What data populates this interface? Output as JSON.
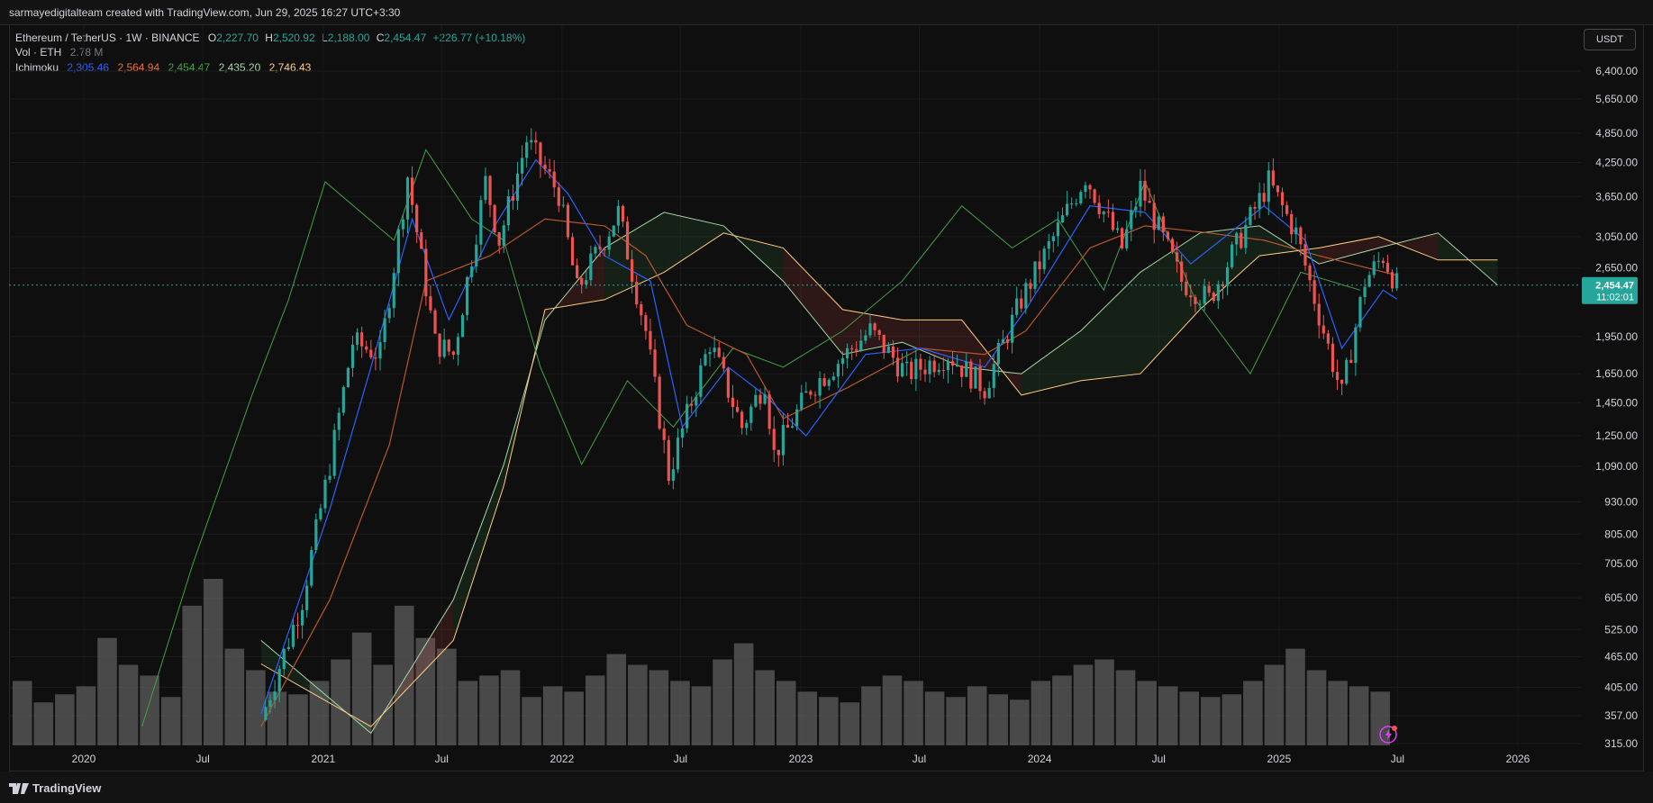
{
  "header": {
    "attribution": "sarmayedigitalteam created with TradingView.com, Jun 29, 2025 16:27 UTC+3:30"
  },
  "legend": {
    "symbol": "Ethereum / TetherUS · 1W · BINANCE",
    "open_label": "O",
    "open": "2,227.70",
    "high_label": "H",
    "high": "2,520.92",
    "low_label": "L",
    "low": "2,188.00",
    "close_label": "C",
    "close": "2,454.47",
    "change": "+226.77 (+10.18%)",
    "volume_label": "Vol · ETH",
    "volume": "2.78 M",
    "ichimoku_label": "Ichimoku",
    "ichimoku_values": [
      "2,305.46",
      "2,564.94",
      "2,454.47",
      "2,435.20",
      "2,746.43"
    ]
  },
  "currency_button": "USDT",
  "last_price": {
    "value": "2,454.47",
    "countdown": "11:02:01"
  },
  "footer": {
    "logo_text": "TradingView"
  },
  "colors": {
    "up": "#26a69a",
    "down": "#ef5350",
    "conversion": "#2962ff",
    "base": "#b7562a",
    "lagging": "#43a047",
    "spanA": "#a5d6a7",
    "spanB": "#ffcc80",
    "volume": "#5d5d5d",
    "price_line": "#26a69a"
  },
  "chart_data": {
    "type": "candlestick",
    "title": "",
    "scale": "log",
    "y_ticks": [
      6400,
      5650,
      4850,
      4250,
      3650,
      3050,
      2650,
      1950,
      1650,
      1450,
      1250,
      1090,
      930,
      805,
      705,
      605,
      525,
      465,
      405,
      357,
      315
    ],
    "y_tick_labels": [
      "6,400.00",
      "5,650.00",
      "4,850.00",
      "4,250.00",
      "3,650.00",
      "3,050.00",
      "2,650.00",
      "1,950.00",
      "1,650.00",
      "1,450.00",
      "1,250.00",
      "1,090.00",
      "930.00",
      "805.00",
      "705.00",
      "605.00",
      "525.00",
      "465.00",
      "405.00",
      "357.00",
      "315.00"
    ],
    "x_labels": [
      "2020",
      "Jul",
      "2021",
      "Jul",
      "2022",
      "Jul",
      "2023",
      "Jul",
      "2024",
      "Jul",
      "2025",
      "Jul",
      "2026"
    ],
    "x_label_dates": [
      "2020-01-01",
      "2020-07-01",
      "2021-01-01",
      "2021-07-01",
      "2022-01-01",
      "2022-07-01",
      "2023-01-01",
      "2023-07-01",
      "2024-01-01",
      "2024-07-01",
      "2025-01-01",
      "2025-07-01",
      "2026-01-01"
    ],
    "price_points": [
      [
        "2020-09-28",
        350
      ],
      [
        "2020-11-30",
        600
      ],
      [
        "2021-01-11",
        1100
      ],
      [
        "2021-02-15",
        1900
      ],
      [
        "2021-03-29",
        1800
      ],
      [
        "2021-05-10",
        4000
      ],
      [
        "2021-06-21",
        1900
      ],
      [
        "2021-07-19",
        1800
      ],
      [
        "2021-09-06",
        3900
      ],
      [
        "2021-09-27",
        3000
      ],
      [
        "2021-11-08",
        4700
      ],
      [
        "2021-12-27",
        3700
      ],
      [
        "2022-01-24",
        2400
      ],
      [
        "2022-03-28",
        3400
      ],
      [
        "2022-05-09",
        2000
      ],
      [
        "2022-06-13",
        1050
      ],
      [
        "2022-08-15",
        1900
      ],
      [
        "2022-10-03",
        1300
      ],
      [
        "2022-11-07",
        1600
      ],
      [
        "2022-11-21",
        1150
      ],
      [
        "2023-01-16",
        1550
      ],
      [
        "2023-04-17",
        2000
      ],
      [
        "2023-06-12",
        1650
      ],
      [
        "2023-08-14",
        1800
      ],
      [
        "2023-10-09",
        1550
      ],
      [
        "2023-12-04",
        2300
      ],
      [
        "2024-03-11",
        4000
      ],
      [
        "2024-05-06",
        2900
      ],
      [
        "2024-06-03",
        3800
      ],
      [
        "2024-08-05",
        2500
      ],
      [
        "2024-09-16",
        2300
      ],
      [
        "2024-12-16",
        3900
      ],
      [
        "2025-01-27",
        3100
      ],
      [
        "2025-03-10",
        2000
      ],
      [
        "2025-04-07",
        1500
      ],
      [
        "2025-05-12",
        2500
      ],
      [
        "2025-06-09",
        2800
      ],
      [
        "2025-06-30",
        2454.47
      ]
    ],
    "conversion_line": [
      [
        "2020-09-28",
        360
      ],
      [
        "2021-01-11",
        900
      ],
      [
        "2021-03-15",
        1700
      ],
      [
        "2021-05-17",
        3300
      ],
      [
        "2021-07-12",
        2100
      ],
      [
        "2021-09-20",
        3200
      ],
      [
        "2021-11-22",
        4300
      ],
      [
        "2022-01-10",
        3700
      ],
      [
        "2022-03-07",
        2800
      ],
      [
        "2022-05-16",
        2500
      ],
      [
        "2022-07-04",
        1300
      ],
      [
        "2022-09-12",
        1700
      ],
      [
        "2022-11-07",
        1500
      ],
      [
        "2023-01-09",
        1250
      ],
      [
        "2023-04-10",
        1800
      ],
      [
        "2023-07-03",
        1850
      ],
      [
        "2023-10-09",
        1700
      ],
      [
        "2023-12-11",
        2200
      ],
      [
        "2024-03-18",
        3500
      ],
      [
        "2024-06-10",
        3400
      ],
      [
        "2024-08-19",
        2700
      ],
      [
        "2024-12-09",
        3500
      ],
      [
        "2025-02-10",
        3000
      ],
      [
        "2025-04-07",
        1850
      ],
      [
        "2025-06-09",
        2400
      ],
      [
        "2025-06-30",
        2305.46
      ]
    ],
    "base_line": [
      [
        "2020-09-28",
        340
      ],
      [
        "2021-01-11",
        600
      ],
      [
        "2021-04-12",
        1200
      ],
      [
        "2021-06-07",
        2500
      ],
      [
        "2021-09-13",
        2800
      ],
      [
        "2021-12-06",
        3300
      ],
      [
        "2022-03-07",
        3200
      ],
      [
        "2022-05-09",
        2800
      ],
      [
        "2022-07-11",
        2050
      ],
      [
        "2022-10-10",
        1800
      ],
      [
        "2022-12-05",
        1350
      ],
      [
        "2023-03-13",
        1550
      ],
      [
        "2023-07-03",
        1850
      ],
      [
        "2023-10-09",
        1800
      ],
      [
        "2023-12-11",
        2000
      ],
      [
        "2024-03-18",
        2900
      ],
      [
        "2024-06-10",
        3200
      ],
      [
        "2024-09-16",
        3100
      ],
      [
        "2024-12-09",
        3000
      ],
      [
        "2025-03-03",
        2800
      ],
      [
        "2025-06-30",
        2564.94
      ]
    ],
    "lagging_span": [
      [
        "2020-03-30",
        340
      ],
      [
        "2020-06-15",
        700
      ],
      [
        "2020-09-14",
        1500
      ],
      [
        "2020-11-09",
        2300
      ],
      [
        "2021-01-04",
        3900
      ],
      [
        "2021-04-19",
        3000
      ],
      [
        "2021-06-07",
        4500
      ],
      [
        "2021-08-16",
        3300
      ],
      [
        "2021-10-04",
        3000
      ],
      [
        "2021-11-29",
        1700
      ],
      [
        "2022-01-31",
        1100
      ],
      [
        "2022-04-11",
        1600
      ],
      [
        "2022-06-20",
        1300
      ],
      [
        "2022-09-19",
        1850
      ],
      [
        "2022-12-05",
        1700
      ],
      [
        "2023-03-06",
        2000
      ],
      [
        "2023-06-05",
        2500
      ],
      [
        "2023-09-04",
        3500
      ],
      [
        "2023-11-20",
        2900
      ],
      [
        "2024-01-29",
        3300
      ],
      [
        "2024-04-08",
        2400
      ],
      [
        "2024-06-10",
        3900
      ],
      [
        "2024-08-26",
        2300
      ],
      [
        "2024-11-18",
        1650
      ],
      [
        "2025-02-03",
        2600
      ],
      [
        "2025-05-05",
        2400
      ]
    ],
    "cloud_span_a": [
      [
        "2020-09-28",
        500
      ],
      [
        "2021-03-15",
        330
      ],
      [
        "2021-07-19",
        600
      ],
      [
        "2021-10-04",
        1100
      ],
      [
        "2021-12-06",
        2100
      ],
      [
        "2022-03-07",
        2900
      ],
      [
        "2022-06-06",
        3400
      ],
      [
        "2022-09-05",
        3200
      ],
      [
        "2022-12-05",
        2500
      ],
      [
        "2023-03-06",
        1800
      ],
      [
        "2023-06-05",
        1900
      ],
      [
        "2023-09-04",
        1700
      ],
      [
        "2023-12-04",
        1650
      ],
      [
        "2024-03-04",
        2000
      ],
      [
        "2024-06-03",
        2600
      ],
      [
        "2024-09-02",
        3100
      ],
      [
        "2024-12-02",
        3200
      ],
      [
        "2025-03-03",
        2700
      ],
      [
        "2025-06-02",
        2900
      ],
      [
        "2025-09-01",
        3100
      ],
      [
        "2025-12-01",
        2454.47
      ]
    ],
    "cloud_span_b": [
      [
        "2020-09-28",
        450
      ],
      [
        "2021-03-15",
        340
      ],
      [
        "2021-07-19",
        500
      ],
      [
        "2021-10-04",
        1000
      ],
      [
        "2021-12-06",
        2200
      ],
      [
        "2022-03-07",
        2300
      ],
      [
        "2022-06-06",
        2600
      ],
      [
        "2022-09-05",
        3100
      ],
      [
        "2022-12-05",
        2900
      ],
      [
        "2023-03-06",
        2200
      ],
      [
        "2023-06-05",
        2100
      ],
      [
        "2023-09-04",
        2100
      ],
      [
        "2023-12-04",
        1500
      ],
      [
        "2024-03-04",
        1600
      ],
      [
        "2024-06-03",
        1650
      ],
      [
        "2024-09-02",
        2200
      ],
      [
        "2024-12-02",
        2800
      ],
      [
        "2025-03-03",
        2900
      ],
      [
        "2025-06-02",
        3050
      ],
      [
        "2025-09-01",
        2746.43
      ],
      [
        "2025-12-01",
        2746.43
      ]
    ],
    "volume_series": [
      120,
      80,
      95,
      110,
      200,
      150,
      130,
      90,
      260,
      310,
      180,
      140,
      100,
      95,
      120,
      160,
      210,
      150,
      260,
      200,
      180,
      120,
      130,
      140,
      90,
      110,
      100,
      130,
      170,
      150,
      140,
      120,
      110,
      160,
      190,
      140,
      120,
      100,
      90,
      80,
      110,
      130,
      120,
      100,
      90,
      110,
      95,
      85,
      120,
      130,
      150,
      160,
      140,
      120,
      110,
      100,
      90,
      95,
      120,
      150,
      180,
      140,
      120,
      110,
      100
    ]
  }
}
